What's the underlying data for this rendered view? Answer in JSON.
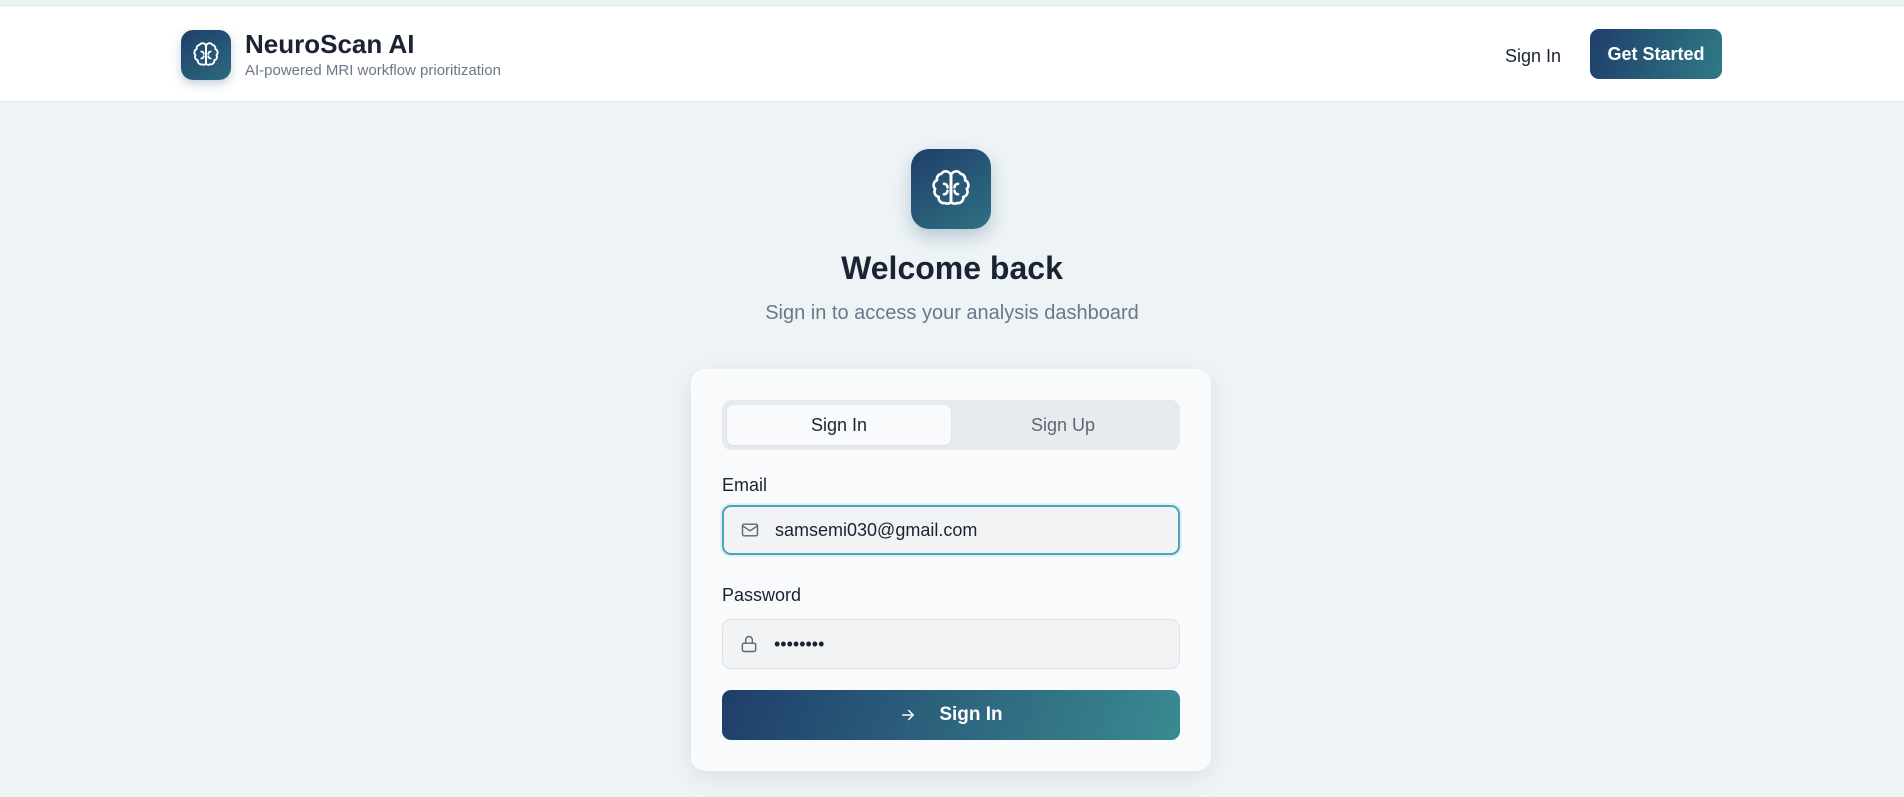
{
  "header": {
    "app_title": "NeuroScan AI",
    "app_subtitle": "AI-powered MRI workflow prioritization",
    "logo_icon": "brain-icon",
    "nav_signin_label": "Sign In",
    "nav_get_started_label": "Get Started"
  },
  "hero": {
    "icon": "brain-icon",
    "title": "Welcome back",
    "subtitle": "Sign in to access your analysis dashboard"
  },
  "auth_card": {
    "tabs": [
      {
        "label": "Sign In",
        "active": true
      },
      {
        "label": "Sign Up",
        "active": false
      }
    ],
    "email": {
      "label": "Email",
      "icon": "mail-icon",
      "value": "samsemi030@gmail.com"
    },
    "password": {
      "label": "Password",
      "icon": "lock-icon",
      "value": "••••••••"
    },
    "submit": {
      "icon": "arrow-right-icon",
      "label": "Sign In"
    }
  },
  "colors": {
    "brand_dark": "#1f3e6a",
    "brand_teal": "#3a8a91",
    "focus_ring": "#4aa6b5",
    "page_bg": "#eef4f6"
  }
}
